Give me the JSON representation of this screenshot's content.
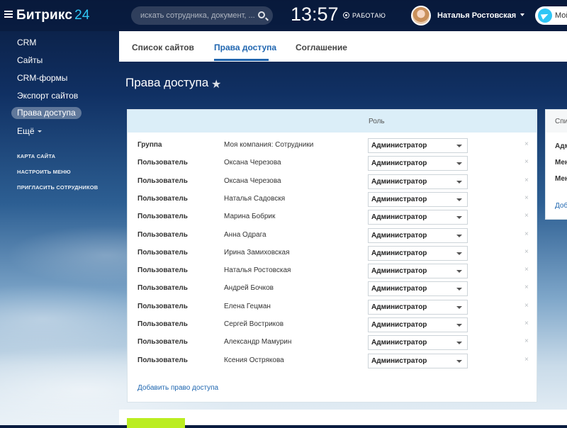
{
  "header": {
    "logo_text": "Битрикс",
    "logo_number": "24",
    "search_placeholder": "искать сотрудника, документ, ...",
    "clock": "13:57",
    "work_status": "РАБОТАЮ",
    "user_name": "Наталья Ростовская",
    "my_label": "Мой"
  },
  "sidebar": {
    "items": [
      {
        "label": "CRM"
      },
      {
        "label": "Сайты"
      },
      {
        "label": "CRM-формы"
      },
      {
        "label": "Экспорт сайтов"
      },
      {
        "label": "Права доступа"
      },
      {
        "label": "Ещё"
      }
    ],
    "links": [
      {
        "label": "КАРТА САЙТА"
      },
      {
        "label": "НАСТРОИТЬ МЕНЮ"
      },
      {
        "label": "ПРИГЛАСИТЬ СОТРУДНИКОВ"
      }
    ]
  },
  "tabs": [
    {
      "label": "Список сайтов"
    },
    {
      "label": "Права доступа"
    },
    {
      "label": "Соглашение"
    }
  ],
  "page": {
    "title": "Права доступа"
  },
  "table": {
    "role_header": "Роль",
    "rows": [
      {
        "type": "Группа",
        "name": "Моя компания: Сотрудники",
        "role": "Администратор"
      },
      {
        "type": "Пользователь",
        "name": "Оксана Черезова",
        "role": "Администратор"
      },
      {
        "type": "Пользователь",
        "name": "Оксана Черезова",
        "role": "Администратор"
      },
      {
        "type": "Пользователь",
        "name": "Наталья Садовскя",
        "role": "Администратор"
      },
      {
        "type": "Пользователь",
        "name": "Марина Бобрик",
        "role": "Администратор"
      },
      {
        "type": "Пользователь",
        "name": "Анна Одрага",
        "role": "Администратор"
      },
      {
        "type": "Пользователь",
        "name": "Ирина Замиховская",
        "role": "Администратор"
      },
      {
        "type": "Пользователь",
        "name": "Наталья Ростовская",
        "role": "Администратор"
      },
      {
        "type": "Пользователь",
        "name": "Андрей Бочков",
        "role": "Администратор"
      },
      {
        "type": "Пользователь",
        "name": "Елена Гецман",
        "role": "Администратор"
      },
      {
        "type": "Пользователь",
        "name": "Сергей Востриков",
        "role": "Администратор"
      },
      {
        "type": "Пользователь",
        "name": "Александр Мамурин",
        "role": "Администратор"
      },
      {
        "type": "Пользователь",
        "name": "Ксения Острякова",
        "role": "Администратор"
      }
    ],
    "add_link": "Добавить право доступа",
    "remove_glyph": "×"
  },
  "side_panel": {
    "header": "Спи",
    "items": [
      "Адм",
      "Мен",
      "Мен"
    ],
    "link": "Доб"
  },
  "colors": {
    "accent": "#2066b0",
    "save_button": "#bbed21",
    "table_header": "#dbeef8"
  }
}
